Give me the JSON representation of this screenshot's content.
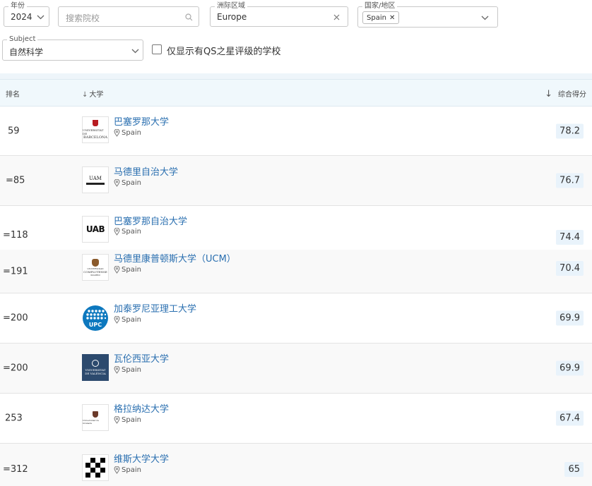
{
  "filters": {
    "year": {
      "label": "年份",
      "value": "2024"
    },
    "search": {
      "placeholder": "搜索院校"
    },
    "region": {
      "label": "洲际区域",
      "value": "Europe"
    },
    "country": {
      "label": "国家/地区",
      "chip": "Spain"
    },
    "subject": {
      "label": "Subject",
      "value": "自然科学"
    },
    "qs_stars_only": {
      "label": "仅显示有QS之星评级的学校",
      "checked": false
    }
  },
  "table": {
    "columns": {
      "rank": "排名",
      "university": "大学",
      "score": "综合得分"
    },
    "rows": [
      {
        "rank": "59",
        "name": "巴塞罗那大学",
        "location": "Spain",
        "score": "78.2"
      },
      {
        "rank": "=85",
        "name": "马德里自治大学",
        "location": "Spain",
        "score": "76.7"
      },
      {
        "rank": "=118",
        "name": "巴塞罗那自治大学",
        "location": "Spain",
        "score": "74.4"
      },
      {
        "rank": "=191",
        "name": "马德里康普顿斯大学（UCM）",
        "location": "Spain",
        "score": "70.4"
      },
      {
        "rank": "=200",
        "name": "加泰罗尼亚理工大学",
        "location": "Spain",
        "score": "69.9"
      },
      {
        "rank": "=200",
        "name": "瓦伦西亚大学",
        "location": "Spain",
        "score": "69.9"
      },
      {
        "rank": "253",
        "name": "格拉纳达大学",
        "location": "Spain",
        "score": "67.4"
      },
      {
        "rank": "=312",
        "name": "维斯大学大学",
        "location": "Spain",
        "score": "65"
      }
    ]
  },
  "logos": {
    "ub": {
      "text_top": "UNIVERSITAT DE",
      "text_bottom": "BARCELONA"
    },
    "uam": {
      "text": "UAM"
    },
    "uab": {
      "text": "UAB"
    },
    "ucm": {
      "text_top": "UNIVERSIDAD",
      "text_mid": "COMPLUTENSE",
      "text_bottom": "MADRID"
    },
    "upc": {
      "text": "UPC"
    },
    "uv": {
      "text_top": "VNIVERSITAT",
      "text_bottom": "DE VALÈNCIA"
    },
    "ugr": {
      "text": "Universidad de Granada"
    }
  },
  "colors": {
    "link": "#2a6fb0",
    "header_bg": "#f0f8fc",
    "score_bg": "#e9f3fb",
    "upc_blue": "#0d78be",
    "uv_navy": "#2c4a6e"
  },
  "icons": [
    "chevron-down-icon",
    "search-icon",
    "clear-icon",
    "close-icon",
    "location-pin-icon",
    "sort-down-arrow-icon"
  ]
}
